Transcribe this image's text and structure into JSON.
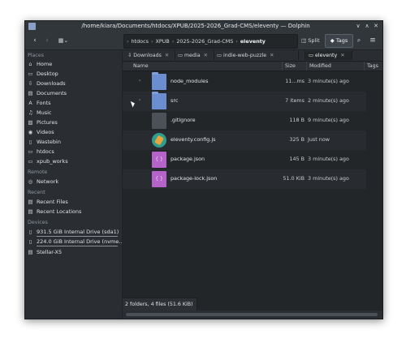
{
  "window": {
    "title": "/home/kiara/Documents/htdocs/XPUB/2025-2026_Grad-CMS/eleventy — Dolphin",
    "controls": [
      "∨",
      "∧",
      "✕"
    ]
  },
  "toolbar": {
    "back_icon": "back-icon",
    "forward_icon": "forward-icon",
    "view_icon": "view-mode-icon",
    "breadcrumb": [
      "htdocs",
      "XPUB",
      "2025-2026_Grad-CMS",
      "eleventy"
    ],
    "split_label": "Split",
    "tags_label": "Tags",
    "search_icon": "search-icon",
    "menu_icon": "hamburger-menu-icon"
  },
  "sidebar": {
    "places_label": "Places",
    "places": [
      {
        "label": "Home",
        "icon": "⌂"
      },
      {
        "label": "Desktop",
        "icon": "▭"
      },
      {
        "label": "Downloads",
        "icon": "⇩"
      },
      {
        "label": "Documents",
        "icon": "▤"
      },
      {
        "label": "Fonts",
        "icon": "A"
      },
      {
        "label": "Music",
        "icon": "♫"
      },
      {
        "label": "Pictures",
        "icon": "▨"
      },
      {
        "label": "Videos",
        "icon": "◉"
      },
      {
        "label": "Wastebin",
        "icon": "▯"
      },
      {
        "label": "htdocs",
        "icon": "▭"
      },
      {
        "label": "xpub_works",
        "icon": "▭"
      }
    ],
    "remote_label": "Remote",
    "remote": [
      {
        "label": "Network",
        "icon": "◎"
      }
    ],
    "recent_label": "Recent",
    "recent": [
      {
        "label": "Recent Files",
        "icon": "▤"
      },
      {
        "label": "Recent Locations",
        "icon": "▤"
      }
    ],
    "devices_label": "Devices",
    "devices": [
      {
        "label": "931.5 GiB Internal Drive (sda1)",
        "icon": "▯"
      },
      {
        "label": "224.0 GiB Internal Drive (nvme...",
        "icon": "▯"
      },
      {
        "label": "Stellar-X5",
        "icon": "▤"
      }
    ]
  },
  "tabs": [
    {
      "label": "Downloads",
      "icon": "⇩"
    },
    {
      "label": "media",
      "icon": "▭"
    },
    {
      "label": "indie-web-puzzle",
      "icon": "▭"
    },
    {
      "label": "eleventy",
      "icon": "▭"
    }
  ],
  "columns": {
    "name": "Name",
    "size": "Size",
    "modified": "Modified",
    "tags": "Tags"
  },
  "files": [
    {
      "name": "node_modules",
      "size": "11...ms",
      "modified": "3 minute(s) ago",
      "type": "folder",
      "expand": "›"
    },
    {
      "name": "src",
      "size": "7 items",
      "modified": "2 minute(s) ago",
      "type": "folder",
      "expand": "›"
    },
    {
      "name": ".gitignore",
      "size": "118 B",
      "modified": "9 minute(s) ago",
      "type": "gitfile",
      "expand": ""
    },
    {
      "name": "eleventy.config.js",
      "size": "325 B",
      "modified": "Just now",
      "type": "jsfile",
      "expand": ""
    },
    {
      "name": "package.json",
      "size": "145 B",
      "modified": "3 minute(s) ago",
      "type": "jsonfile",
      "expand": ""
    },
    {
      "name": "package-lock.json",
      "size": "51.0 KiB",
      "modified": "3 minute(s) ago",
      "type": "jsonfile",
      "expand": ""
    }
  ],
  "status": "2 folders, 4 files (51.6 KiB)"
}
